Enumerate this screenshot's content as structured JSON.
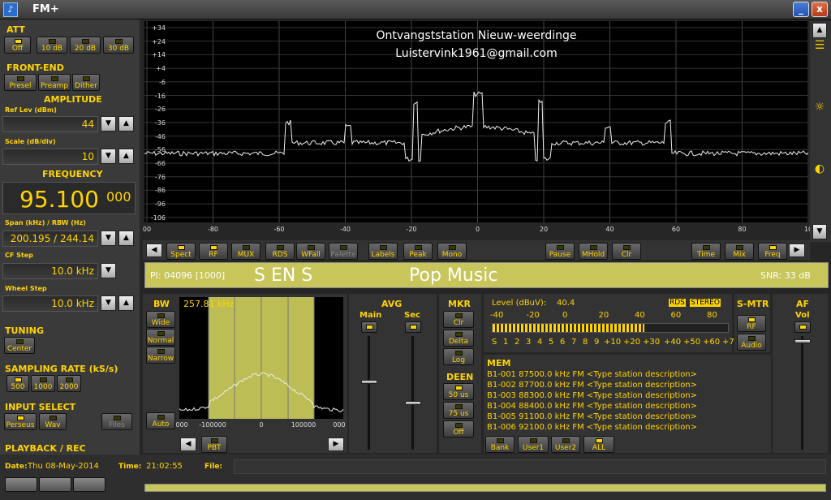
{
  "window": {
    "title": "FM+",
    "min": "_",
    "close": "x"
  },
  "att": {
    "title": "ATT",
    "buttons": [
      "Off",
      "10 dB",
      "20 dB",
      "30 dB"
    ]
  },
  "frontend": {
    "title": "FRONT-END",
    "buttons": [
      "Presel",
      "Preamp",
      "Dither"
    ]
  },
  "amplitude": {
    "title": "AMPLITUDE",
    "ref_label": "Ref Lev (dBm)",
    "ref_value": "44",
    "scale_label": "Scale (dB/div)",
    "scale_value": "10"
  },
  "frequency": {
    "title": "FREQUENCY",
    "main": "95.100",
    "small": "000",
    "span_label": "Span (kHz) / RBW (Hz)",
    "span_value": "200.195 / 244.14",
    "cf_label": "CF Step",
    "cf_value": "10.0 kHz",
    "wheel_label": "Wheel Step",
    "wheel_value": "10.0 kHz"
  },
  "tuning": {
    "title": "TUNING",
    "button": "Center"
  },
  "sampling": {
    "title": "SAMPLING RATE (kS/s)",
    "buttons": [
      "500",
      "1000",
      "2000"
    ]
  },
  "input": {
    "title": "INPUT SELECT",
    "buttons": [
      "Perseus",
      "Wav",
      "Files"
    ]
  },
  "playback": {
    "title": "PLAYBACK / REC"
  },
  "status": {
    "date_label": "Date:",
    "date": "Thu 08-May-2014",
    "time_label": "Time:",
    "time": "21:02:55",
    "file_label": "File:"
  },
  "spectrum": {
    "overlay1": "Ontvangststation Nieuw-weerdinge",
    "overlay2": "Luistervink1961@gmail.com",
    "yticks": [
      "+34",
      "+24",
      "+14",
      "+4",
      "-6",
      "-16",
      "-26",
      "-36",
      "-46",
      "-56",
      "-66",
      "-76",
      "-86",
      "-96",
      "-106"
    ],
    "xticks": [
      "00",
      "-80",
      "-60",
      "-40",
      "-20",
      "0",
      "20",
      "40",
      "60",
      "80",
      "10"
    ]
  },
  "toolbar": {
    "left": [
      "Spect",
      "RF",
      "MUX",
      "RDS",
      "WFall",
      "Palette",
      "Labels",
      "Peak",
      "Mono"
    ],
    "right1": [
      "Pause",
      "MHold",
      "Clr"
    ],
    "right2": [
      "Time",
      "Mix",
      "Freq"
    ]
  },
  "rds": {
    "pi": "PI: 04096 [1000]",
    "ps": "S EN S",
    "pty": "Pop Music",
    "snr": "SNR: 33 dB"
  },
  "bw": {
    "title": "BW",
    "buttons": [
      "Wide",
      "Normal",
      "Narrow",
      "Auto"
    ],
    "value": "257.81 kHz",
    "xticks": [
      "000",
      "-100000",
      "0",
      "100000",
      "000"
    ],
    "pbt": "PBT"
  },
  "avg": {
    "title": "AVG",
    "main": "Main",
    "sec": "Sec"
  },
  "mkr": {
    "title": "MKR",
    "buttons": [
      "Clr",
      "Delta",
      "Log"
    ]
  },
  "deen": {
    "title": "DEEN",
    "buttons": [
      "50 us",
      "75 us",
      "Off"
    ]
  },
  "level": {
    "label": "Level (dBuV):",
    "value": "40.4",
    "rds": "RDS",
    "stereo": "STEREO",
    "scale_top": [
      "-40",
      "-20",
      "0",
      "20",
      "40",
      "60",
      "80"
    ],
    "scale_bottom": [
      "S",
      "1",
      "2",
      "3",
      "4",
      "5",
      "6",
      "7",
      "8",
      "9",
      "+10",
      "+20",
      "+30",
      "+40",
      "+50",
      "+60",
      "+70"
    ]
  },
  "smtr": {
    "title": "S-MTR",
    "buttons": [
      "RF",
      "Audio"
    ]
  },
  "af": {
    "title": "AF",
    "vol": "Vol"
  },
  "mem": {
    "title": "MEM",
    "rows": [
      "B1-001 87500.0 kHz  FM  <Type station description>",
      "B1-002 87700.0 kHz  FM  <Type station description>",
      "B1-003 88300.0 kHz  FM  <Type station description>",
      "B1-004 88400.0 kHz  FM  <Type station description>",
      "B1-005 91100.0 kHz  FM  <Type station description>",
      "B1-006 92100.0 kHz  FM  <Type station description>"
    ],
    "buttons": [
      "Bank",
      "User1",
      "User2",
      "ALL"
    ]
  },
  "colors": {
    "accent": "#ffd400",
    "rds_bg": "#c8c55a",
    "bw_fill": "#bdbd55"
  }
}
